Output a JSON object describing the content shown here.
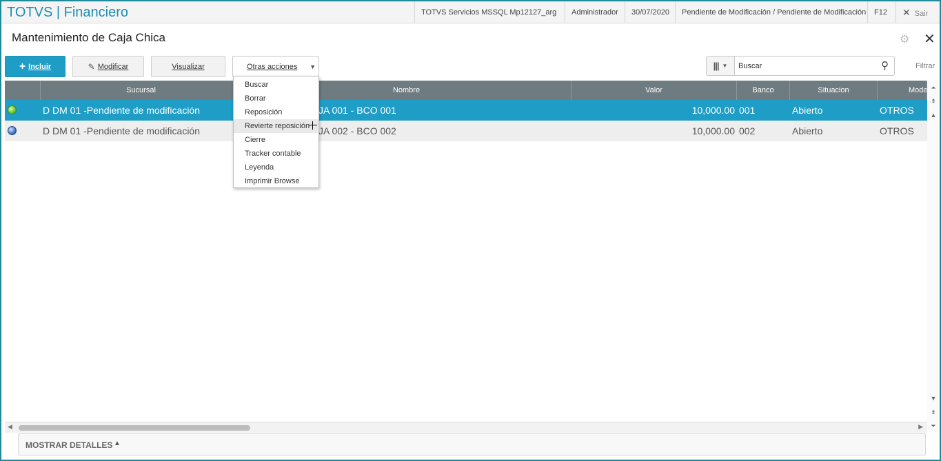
{
  "topbar": {
    "app_title": "TOTVS | Financiero",
    "environment": "TOTVS Servicios MSSQL Mp12127_arg",
    "user": "Administrador",
    "date": "30/07/2020",
    "branch": "Pendiente de Modificación / Pendiente de Modificación",
    "shortcut": "F12",
    "exit_label": "Sair"
  },
  "page": {
    "title": "Mantenimiento de Caja Chica"
  },
  "toolbar": {
    "incluir": "Incluir",
    "modificar": "Modificar",
    "visualizar": "Visualizar",
    "otras": "Otras acciones"
  },
  "search": {
    "placeholder": "Buscar",
    "filter_label": "Filtrar"
  },
  "grid": {
    "columns": [
      "",
      "Sucursal",
      "Nombre",
      "Valor",
      "Banco",
      "Situacion",
      "Moda"
    ],
    "rows": [
      {
        "status": "green",
        "sucursal": "D DM 01 -Pendiente de modificación",
        "nombre": "JA 001 - BCO 001",
        "valor": "10,000.00",
        "banco": "001",
        "situacion": "Abierto",
        "moda": "OTROS"
      },
      {
        "status": "blue",
        "sucursal": "D DM 01 -Pendiente de modificación",
        "nombre": "JA 002 - BCO 002",
        "valor": "10,000.00",
        "banco": "002",
        "situacion": "Abierto",
        "moda": "OTROS"
      }
    ]
  },
  "menu": {
    "items": [
      "Buscar",
      "Borrar",
      "Reposición",
      "Revierte reposición",
      "Cierre",
      "Tracker contable",
      "Leyenda",
      "Imprimir Browse"
    ],
    "hovered": "Revierte reposición"
  },
  "footer": {
    "details_label": "MOSTRAR DETALLES"
  },
  "colors": {
    "accent": "#1e9dc6",
    "header_bg": "#6e7b80",
    "title_blue": "#1a8fb3"
  }
}
